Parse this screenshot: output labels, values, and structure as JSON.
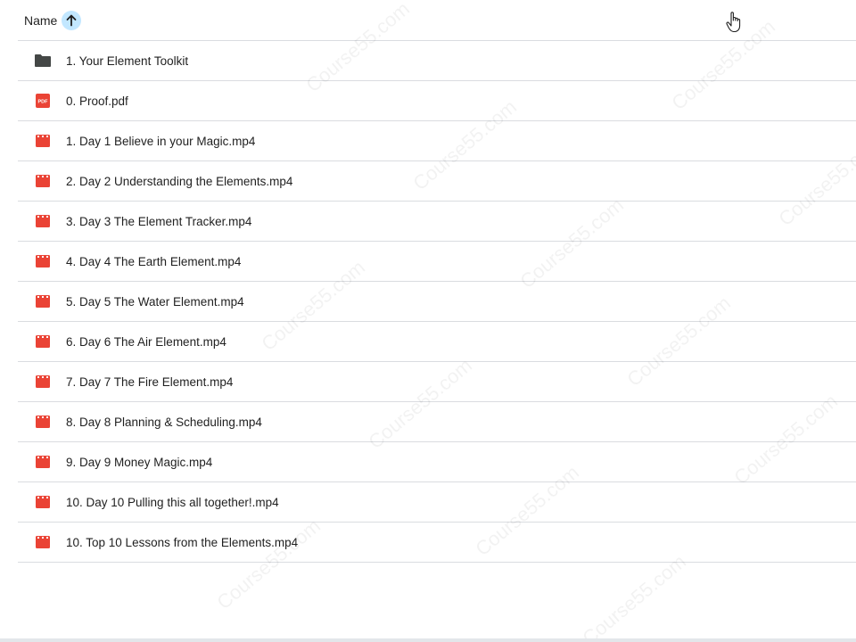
{
  "header": {
    "column_label": "Name",
    "sort_icon": "arrow-upward-icon",
    "sort_direction": "ascending"
  },
  "colors": {
    "folder": "#444746",
    "video": "#ea4335",
    "pdf": "#ea4335",
    "sort_highlight": "#c2e7ff",
    "divider": "#dadce0"
  },
  "files": [
    {
      "name": "1. Your Element Toolkit",
      "icon": "folder-icon"
    },
    {
      "name": "0. Proof.pdf",
      "icon": "pdf-icon"
    },
    {
      "name": "1. Day 1 Believe in your Magic.mp4",
      "icon": "video-icon"
    },
    {
      "name": "2. Day 2 Understanding the Elements.mp4",
      "icon": "video-icon"
    },
    {
      "name": "3. Day 3  The Element Tracker.mp4",
      "icon": "video-icon"
    },
    {
      "name": "4. Day 4  The Earth Element.mp4",
      "icon": "video-icon"
    },
    {
      "name": "5. Day 5  The Water Element.mp4",
      "icon": "video-icon"
    },
    {
      "name": "6. Day 6 The Air Element.mp4",
      "icon": "video-icon"
    },
    {
      "name": "7. Day 7  The Fire Element.mp4",
      "icon": "video-icon"
    },
    {
      "name": "8. Day 8  Planning & Scheduling.mp4",
      "icon": "video-icon"
    },
    {
      "name": "9. Day 9  Money Magic.mp4",
      "icon": "video-icon"
    },
    {
      "name": "10. Day 10  Pulling this all together!.mp4",
      "icon": "video-icon"
    },
    {
      "name": "10. Top 10 Lessons from the Elements.mp4",
      "icon": "video-icon"
    }
  ],
  "watermark_text": "Course55.com"
}
